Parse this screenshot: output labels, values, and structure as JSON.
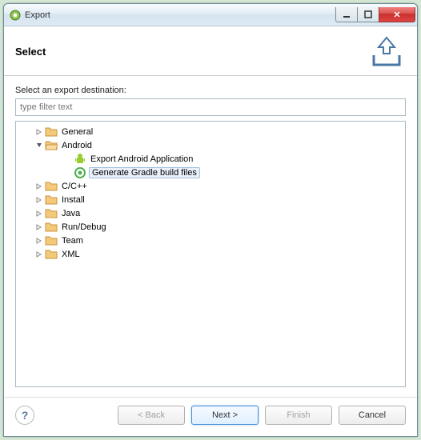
{
  "window": {
    "title": "Export"
  },
  "header": {
    "title": "Select"
  },
  "content": {
    "prompt": "Select an export destination:",
    "filter_placeholder": "type filter text"
  },
  "tree": {
    "general": "General",
    "android": "Android",
    "export_app": "Export Android Application",
    "gen_gradle": "Generate Gradle build files",
    "ccpp": "C/C++",
    "install": "Install",
    "java": "Java",
    "rundebug": "Run/Debug",
    "team": "Team",
    "xml": "XML"
  },
  "buttons": {
    "back": "< Back",
    "next": "Next >",
    "finish": "Finish",
    "cancel": "Cancel"
  }
}
